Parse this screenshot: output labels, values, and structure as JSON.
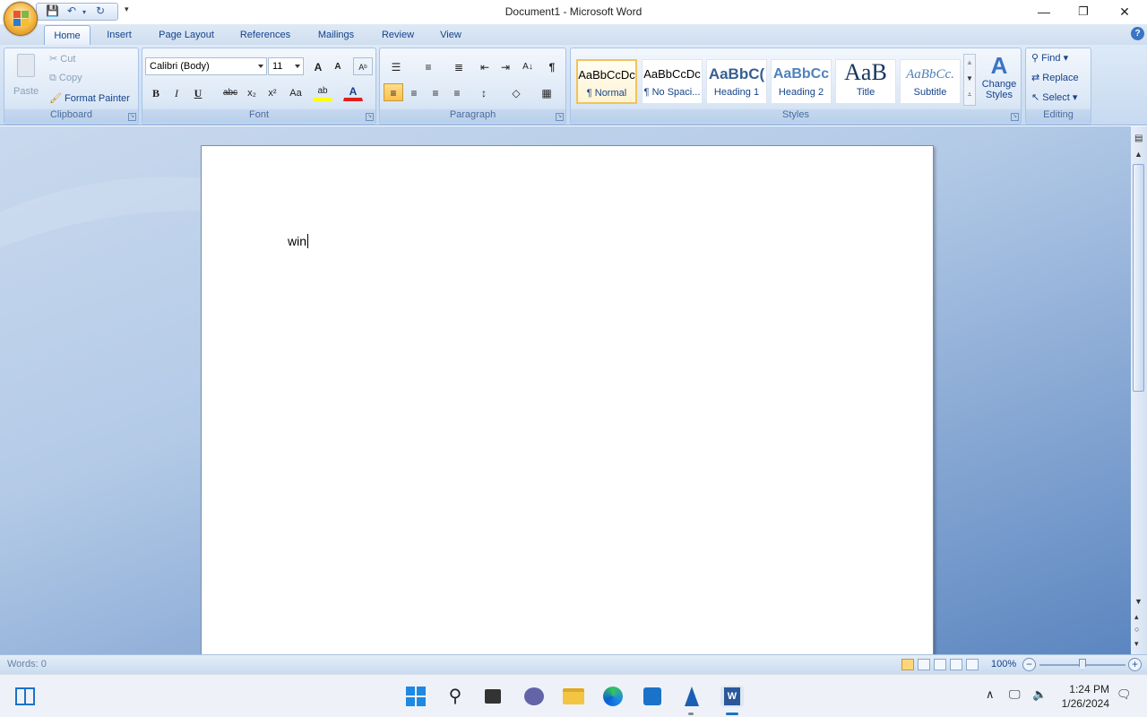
{
  "window": {
    "title": "Document1 - Microsoft Word",
    "minimize": "—",
    "restore": "❐",
    "close": "✕"
  },
  "qat": {
    "save": "💾",
    "undo": "↶",
    "redo": "↻",
    "more": "▾"
  },
  "tabs": [
    "Home",
    "Insert",
    "Page Layout",
    "References",
    "Mailings",
    "Review",
    "View"
  ],
  "help": "?",
  "clipboard": {
    "label": "Clipboard",
    "paste": "Paste",
    "cut": "Cut",
    "copy": "Copy",
    "format_painter": "Format Painter"
  },
  "font": {
    "label": "Font",
    "name": "Calibri (Body)",
    "size": "11",
    "grow": "A",
    "shrink": "A",
    "clear": "Aᵇ",
    "bold": "B",
    "italic": "I",
    "underline": "U",
    "strike": "abc",
    "subscript": "x₂",
    "superscript": "x²",
    "change_case": "Aa",
    "highlight": "ab",
    "font_color": "A"
  },
  "paragraph": {
    "label": "Paragraph",
    "bullets": "☰",
    "numbering": "≡",
    "multilevel": "≣",
    "decrease_indent": "⇤",
    "increase_indent": "⇥",
    "sort": "A↓",
    "show_marks": "¶",
    "align_left": "≡",
    "center": "≡",
    "align_right": "≡",
    "justify": "≡",
    "line_spacing": "↕",
    "shading": "◇",
    "borders": "▦"
  },
  "styles": {
    "label": "Styles",
    "tiles": [
      {
        "sample": "AaBbCcDc",
        "name": "¶ Normal"
      },
      {
        "sample": "AaBbCcDc",
        "name": "¶ No Spaci..."
      },
      {
        "sample": "AaBbC(",
        "name": "Heading 1"
      },
      {
        "sample": "AaBbCc",
        "name": "Heading 2"
      },
      {
        "sample": "AaB",
        "name": "Title"
      },
      {
        "sample": "AaBbCc.",
        "name": "Subtitle"
      }
    ],
    "change_styles_line1": "Change",
    "change_styles_line2": "Styles"
  },
  "editing": {
    "label": "Editing",
    "find": "Find",
    "replace": "Replace",
    "select": "Select"
  },
  "document": {
    "text": "win"
  },
  "status": {
    "words": "Words: 0",
    "zoom": "100%"
  },
  "taskbar": {
    "time": "1:24 PM",
    "date": "1/26/2024"
  },
  "colors": {
    "accent": "#15428b",
    "ribbon": "#dde9f7",
    "highlight": "#ffdc8a"
  }
}
